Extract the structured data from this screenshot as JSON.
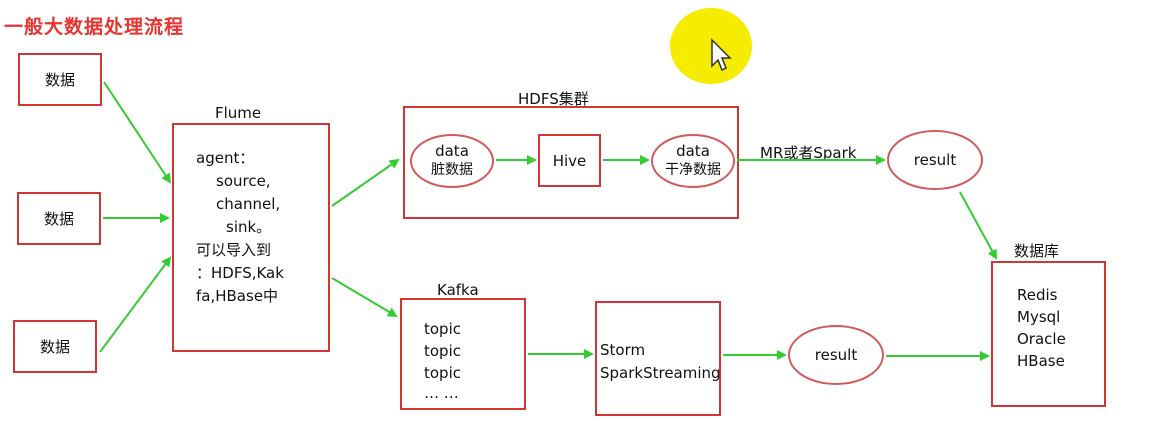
{
  "title": "一般大数据处理流程",
  "sources": [
    "数据",
    "数据",
    "数据"
  ],
  "flume": {
    "title": "Flume",
    "lines": [
      "agent：",
      "source,",
      "channel,",
      "sink。",
      "可以导入到",
      "：HDFS,Kak",
      "fa,HBase中"
    ]
  },
  "hdfs": {
    "title": "HDFS集群",
    "dirty_data": [
      "data",
      "脏数据"
    ],
    "hive": "Hive",
    "clean_data": [
      "data",
      "干净数据"
    ]
  },
  "mr_label": "MR或者Spark",
  "result_top": "result",
  "kafka": {
    "title": "Kafka",
    "lines": [
      "topic",
      "topic",
      "topic",
      "… …"
    ]
  },
  "stream": {
    "lines": [
      "Storm",
      "SparkStreaming"
    ]
  },
  "result_bottom": "result",
  "database": {
    "title": "数据库",
    "lines": [
      "Redis",
      "Mysql",
      "Oracle",
      "HBase"
    ]
  },
  "colors": {
    "title": "#e8332f",
    "box_border": "#d33434",
    "arrow": "#33cc33",
    "cursor_highlight": "#f5ec00"
  }
}
